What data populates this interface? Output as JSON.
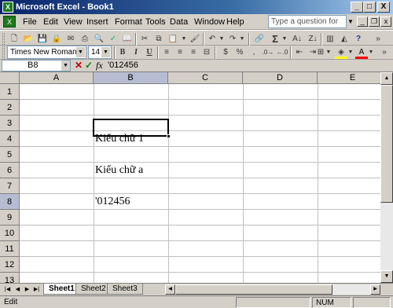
{
  "window": {
    "title": "Microsoft Excel - Book1",
    "min": "_",
    "max": "□",
    "close": "X"
  },
  "menubar": {
    "items": [
      {
        "label": "File"
      },
      {
        "label": "Edit"
      },
      {
        "label": "View"
      },
      {
        "label": "Insert"
      },
      {
        "label": "Format"
      },
      {
        "label": "Tools"
      },
      {
        "label": "Data"
      },
      {
        "label": "Window"
      },
      {
        "label": "Help"
      }
    ],
    "help_placeholder": "Type a question for help"
  },
  "formatting": {
    "font": "Times New Roman",
    "size": "14",
    "bold": "B",
    "italic": "I",
    "underline": "U",
    "currency": "$",
    "percent": "%"
  },
  "formula_bar": {
    "name_box": "B8",
    "cancel": "✕",
    "enter": "✓",
    "fx": "fx",
    "content": "'012456"
  },
  "columns": [
    "A",
    "B",
    "C",
    "D",
    "E"
  ],
  "rows": [
    "1",
    "2",
    "3",
    "4",
    "5",
    "6",
    "7",
    "8",
    "9",
    "10",
    "11",
    "12",
    "13"
  ],
  "cells": {
    "B4": "Kiểu chữ 1",
    "B6": "Kiểu chữ a",
    "B8": "'012456"
  },
  "sheets": [
    {
      "label": "Sheet1"
    },
    {
      "label": "Sheet2"
    },
    {
      "label": "Sheet3"
    }
  ],
  "status": {
    "mode": "Edit",
    "num": "NUM"
  },
  "colors": {
    "titlebar": "#0a246a",
    "selected_header": "#b6bdd2",
    "font_color": "#ff0000",
    "fill_color": "#ffff00"
  }
}
